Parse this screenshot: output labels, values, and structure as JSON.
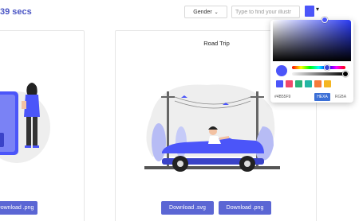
{
  "header": {
    "timer_text": "39 secs",
    "gender_label": "Gender",
    "search_placeholder": "Type to find your illustr",
    "selected_color": "#4b55f9"
  },
  "cards": [
    {
      "title": "s",
      "buttons": [
        "Download .png"
      ]
    },
    {
      "title": "Road Trip",
      "buttons": [
        "Download .svg",
        "Download .png"
      ]
    }
  ],
  "color_picker": {
    "hue_color": "#2b3bf3",
    "preview_color": "#4b55f9",
    "presets": [
      "#4b55f9",
      "#f0486b",
      "#2ab37a",
      "#23b6a4",
      "#f57a3a",
      "#f5b623"
    ],
    "hex_value": "#4B55F9",
    "format_hexa": "HEXA",
    "format_rgba": "RGBA",
    "active_format": "HEXA"
  }
}
